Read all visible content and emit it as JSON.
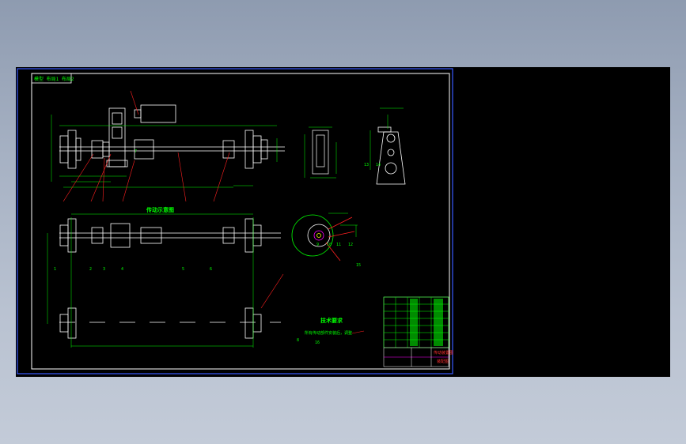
{
  "tab": {
    "label": "模型 布局1 布局2"
  },
  "views": {
    "front_view_title": "传动示意图",
    "tech_title": "技术要求",
    "tech_note": "所有传动部件安装后，调整"
  },
  "dimension_labels": [
    "1",
    "2",
    "3",
    "4",
    "5",
    "6",
    "7",
    "8",
    "9",
    "10",
    "11",
    "12",
    "13",
    "14",
    "15",
    "16"
  ],
  "title_block": {
    "header": "传动装置图",
    "sub": "装配图"
  },
  "colors": {
    "background": "#000000",
    "frame": "#ffffff",
    "outer_frame": "#3a5bff",
    "geometry": "#ffffff",
    "dimension": "#00ff00",
    "leader": "#ff2020",
    "hidden": "#ffff00",
    "accent": "#ff00ff"
  }
}
